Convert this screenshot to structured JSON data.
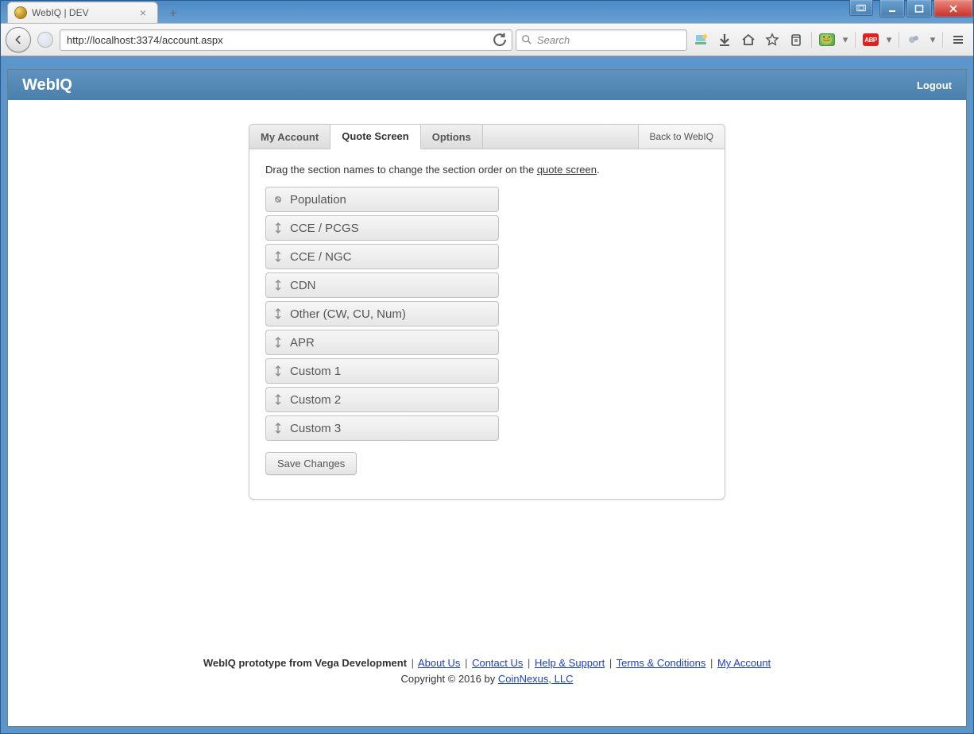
{
  "browser": {
    "tab_title": "WebIQ | DEV",
    "url": "http://localhost:3374/account.aspx",
    "search_placeholder": "Search"
  },
  "app": {
    "title": "WebIQ",
    "logout_label": "Logout"
  },
  "panel": {
    "tabs": {
      "my_account": "My Account",
      "quote_screen": "Quote Screen",
      "options": "Options"
    },
    "back_link": "Back to WebIQ",
    "instructions_prefix": "Drag the section names to change the section order on the ",
    "instructions_link": "quote screen",
    "instructions_suffix": ".",
    "sections": [
      {
        "label": "Population",
        "pinned": true
      },
      {
        "label": "CCE / PCGS",
        "pinned": false
      },
      {
        "label": "CCE / NGC",
        "pinned": false
      },
      {
        "label": "CDN",
        "pinned": false
      },
      {
        "label": "Other (CW, CU, Num)",
        "pinned": false
      },
      {
        "label": "APR",
        "pinned": false
      },
      {
        "label": "Custom 1",
        "pinned": false
      },
      {
        "label": "Custom 2",
        "pinned": false
      },
      {
        "label": "Custom 3",
        "pinned": false
      }
    ],
    "save_button": "Save Changes"
  },
  "footer": {
    "lead": "WebIQ prototype from Vega Development",
    "links": {
      "about": "About Us",
      "contact": "Contact Us",
      "help": "Help & Support",
      "terms": "Terms & Conditions",
      "account": "My Account"
    },
    "copyright_prefix": "Copyright © 2016 by ",
    "copyright_link": "CoinNexus, LLC"
  }
}
